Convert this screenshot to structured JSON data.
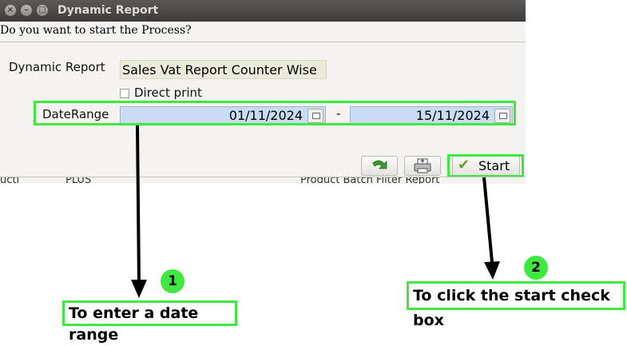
{
  "window": {
    "title": "Dynamic Report",
    "question": "Do you want to start the Process?"
  },
  "form": {
    "report_label": "Dynamic Report",
    "report_value": "Sales Vat Report Counter Wise",
    "direct_print_label": "Direct print",
    "direct_print_checked": false,
    "daterange_label": "DateRange",
    "date_from": "01/11/2024",
    "date_separator": "-",
    "date_to": "15/11/2024"
  },
  "buttons": {
    "start_label": "Start",
    "refresh_icon": "green-arrow-icon",
    "print_icon": "printer-icon"
  },
  "background_strip": {
    "left_text": "ucti",
    "mid_text": "PLUS",
    "right_text": "Product Batch Filter Report"
  },
  "annotations": {
    "step1_number": "1",
    "step1_text": "To enter a date range",
    "step2_number": "2",
    "step2_text": "To click the start check box",
    "highlight_color": "#3ee83e"
  }
}
